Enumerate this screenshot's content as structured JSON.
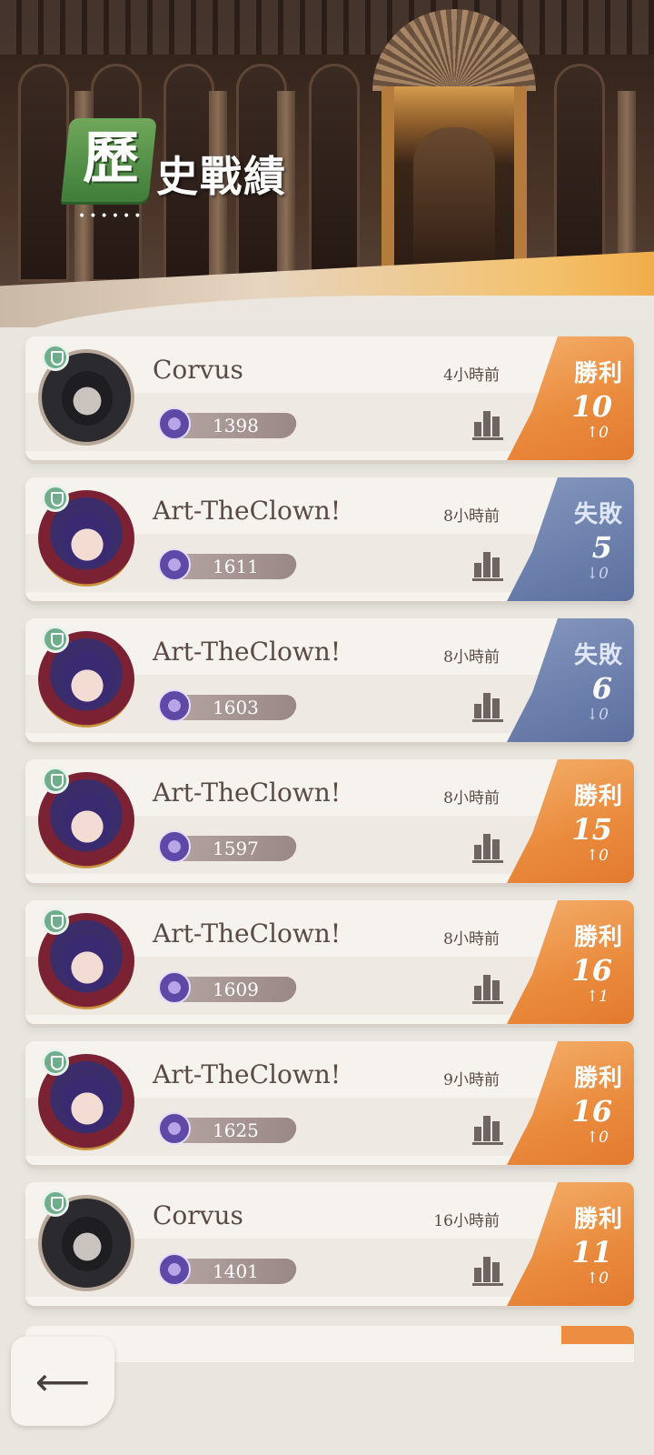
{
  "header": {
    "title_badge_char": "歷",
    "title_rest": "史戰績",
    "decor_dots": "••••••"
  },
  "matches": [
    {
      "opponent": "Corvus",
      "time_ago": "4小時前",
      "rating": "1398",
      "result_label": "勝利",
      "result_value": "10",
      "delta": "↑0",
      "result_type": "win",
      "avatar": "corvus"
    },
    {
      "opponent": "Art-TheClown!",
      "time_ago": "8小時前",
      "rating": "1611",
      "result_label": "失敗",
      "result_value": "5",
      "delta": "↓0",
      "result_type": "loss",
      "avatar": "clown"
    },
    {
      "opponent": "Art-TheClown!",
      "time_ago": "8小時前",
      "rating": "1603",
      "result_label": "失敗",
      "result_value": "6",
      "delta": "↓0",
      "result_type": "loss",
      "avatar": "clown"
    },
    {
      "opponent": "Art-TheClown!",
      "time_ago": "8小時前",
      "rating": "1597",
      "result_label": "勝利",
      "result_value": "15",
      "delta": "↑0",
      "result_type": "win",
      "avatar": "clown"
    },
    {
      "opponent": "Art-TheClown!",
      "time_ago": "8小時前",
      "rating": "1609",
      "result_label": "勝利",
      "result_value": "16",
      "delta": "↑1",
      "result_type": "win",
      "avatar": "clown"
    },
    {
      "opponent": "Art-TheClown!",
      "time_ago": "9小時前",
      "rating": "1625",
      "result_label": "勝利",
      "result_value": "16",
      "delta": "↑0",
      "result_type": "win",
      "avatar": "clown"
    },
    {
      "opponent": "Corvus",
      "time_ago": "16小時前",
      "rating": "1401",
      "result_label": "勝利",
      "result_value": "11",
      "delta": "↑0",
      "result_type": "win",
      "avatar": "corvus"
    }
  ],
  "icons": {
    "back": "arrow-left-icon",
    "stats": "bar-chart-icon",
    "rank": "trophy-icon",
    "verified": "shield-icon"
  },
  "colors": {
    "win": "#e98a3c",
    "loss": "#6c7fac",
    "title_badge": "#4f8e45"
  }
}
